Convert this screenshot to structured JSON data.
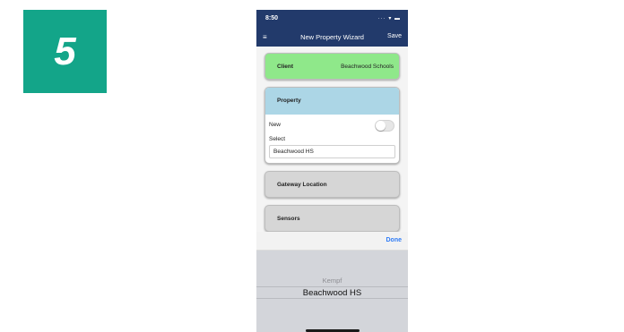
{
  "step": {
    "number": "5",
    "color": "#13a589"
  },
  "status_bar": {
    "time": "8:50",
    "icons": "··· ▾ ▬"
  },
  "nav": {
    "menu_icon": "≡",
    "title": "New Property Wizard",
    "save_label": "Save",
    "color": "#223a6b"
  },
  "client": {
    "label": "Client",
    "value": "Beachwood Schools",
    "color": "#8fe88a"
  },
  "property": {
    "label": "Property",
    "color": "#acd6e6",
    "new_label": "New",
    "new_toggle_on": false,
    "select_label": "Select",
    "select_value": "Beachwood HS"
  },
  "gateway": {
    "label": "Gateway Location"
  },
  "sensors": {
    "label": "Sensors"
  },
  "picker": {
    "done_label": "Done",
    "done_color": "#2f7cf6",
    "options_visible": [
      "Kempf",
      "Beachwood HS"
    ],
    "selected": "Beachwood HS"
  }
}
